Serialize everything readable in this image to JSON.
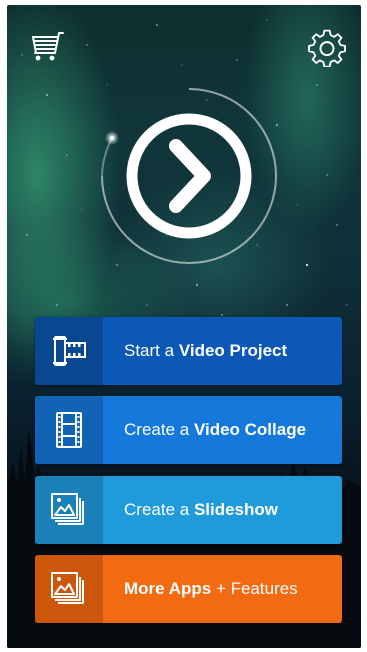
{
  "header": {
    "cart_icon": "shopping-cart-icon",
    "settings_icon": "gear-icon"
  },
  "hero": {
    "play_icon": "chevron-right-icon"
  },
  "buttons": [
    {
      "prefix": "Start a ",
      "bold": "Video Project",
      "suffix": "",
      "icon": "film-strip-icon",
      "color": "#0c58b6"
    },
    {
      "prefix": "Create a ",
      "bold": "Video Collage",
      "suffix": "",
      "icon": "film-frames-icon",
      "color": "#1479da"
    },
    {
      "prefix": "Create a ",
      "bold": "Slideshow",
      "suffix": "",
      "icon": "photo-stack-icon",
      "color": "#1f9adb"
    },
    {
      "prefix": "",
      "bold": "More Apps",
      "suffix": " + Features",
      "icon": "photo-stack-icon",
      "color": "#f26a11"
    }
  ]
}
